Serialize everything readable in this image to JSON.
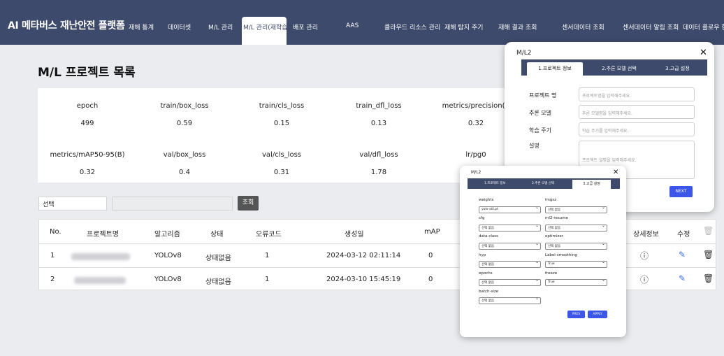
{
  "nav": {
    "brand": "AI 메타버스 재난안전 플랫폼",
    "items": [
      "재해 통계",
      "데이터셋",
      "M/L 관리",
      "M/L 관리(재학습)",
      "배포 관리",
      "AAS",
      "클라우드 리소스 관리",
      "재해 탐지 주기",
      "재해 결과 조회",
      "센서데이터 조회",
      "센서데이터 알림 조회",
      "데이터 플로우 현황"
    ]
  },
  "page": {
    "title": "M/L 프로젝트 목록"
  },
  "metrics": {
    "row1": [
      {
        "label": "epoch",
        "value": "499"
      },
      {
        "label": "train/box_loss",
        "value": "0.59"
      },
      {
        "label": "train/cls_loss",
        "value": "0.15"
      },
      {
        "label": "train_dfl_loss",
        "value": "0.13"
      },
      {
        "label": "metrics/precision(B",
        "value": "0.32"
      }
    ],
    "row2": [
      {
        "label": "metrics/mAP50-95(B)",
        "value": "0.32"
      },
      {
        "label": "val/box_loss",
        "value": "0.4"
      },
      {
        "label": "val/cls_loss",
        "value": "0.31"
      },
      {
        "label": "val/dfl_loss",
        "value": "1.78"
      },
      {
        "label": "lr/pg0",
        "value": ""
      }
    ]
  },
  "filter": {
    "select_value": "선택",
    "search_label": "조회"
  },
  "table": {
    "headers": [
      "No.",
      "프로젝트명",
      "알고리즘",
      "상태",
      "오류코드",
      "생성일",
      "mAP",
      "상세정보",
      "수정"
    ],
    "rows": [
      {
        "no": "1",
        "algorithm": "YOLOv8",
        "status": "상태없음",
        "error_code": "1",
        "created": "2024-03-12 02:11:14",
        "map": "0"
      },
      {
        "no": "2",
        "algorithm": "YOLOv8",
        "status": "상태없음",
        "error_code": "1",
        "created": "2024-03-10 15:45:19",
        "map": "0"
      }
    ]
  },
  "modal1": {
    "title": "M/L2",
    "tabs": [
      "1.프로젝트 정보",
      "2.추론 모델 선택",
      "3.고급 설정"
    ],
    "fields": [
      {
        "label": "프로젝트 명",
        "placeholder": "프로젝트명을 입력해주세요."
      },
      {
        "label": "추론 모델",
        "placeholder": "추론 모델명을 입력해주세요."
      },
      {
        "label": "학습 주기",
        "placeholder": "학습 주기를 입력해주세요."
      },
      {
        "label": "설명",
        "placeholder": "프로젝트 설명을 입력해주세요."
      }
    ],
    "next_label": "NEXT"
  },
  "modal2": {
    "title": "M/L2",
    "tabs": [
      "1.프로젝트 정보",
      "2.추론 모델 선택",
      "3.고급 설정"
    ],
    "left_fields": [
      {
        "label": "weights",
        "value": "yolo-stil.pt"
      },
      {
        "label": "cfg",
        "value": "선택 없음"
      },
      {
        "label": "data-class",
        "value": "선택 없음"
      },
      {
        "label": "hyp",
        "value": "선택 없음"
      },
      {
        "label": "epochs",
        "value": "선택 없음"
      },
      {
        "label": "batch-size",
        "value": "선택 없음"
      }
    ],
    "right_fields": [
      {
        "label": "imgsz",
        "value": "선택 없음"
      },
      {
        "label": "ml2-resume",
        "value": "선택 없음"
      },
      {
        "label": "optimizer",
        "value": "선택 없음"
      },
      {
        "label": "Label-smoothing",
        "value": "True"
      },
      {
        "label": "freeze",
        "value": "True"
      }
    ],
    "prev_label": "PREV",
    "apply_label": "APPLY"
  }
}
